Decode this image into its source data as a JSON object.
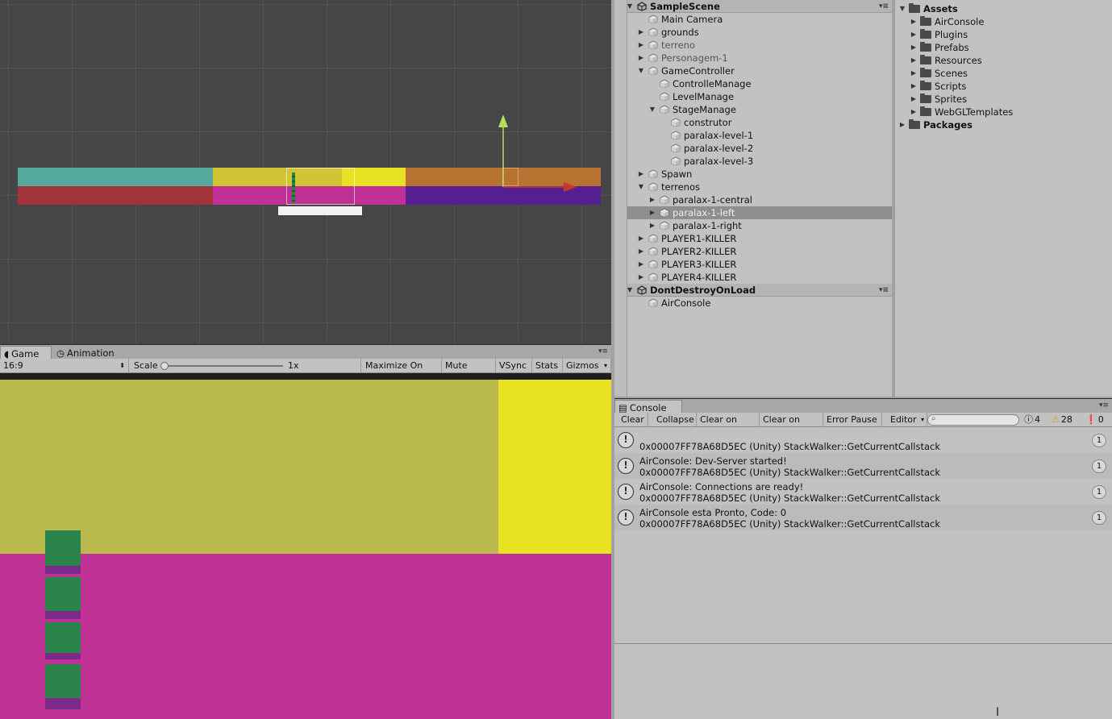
{
  "game_panel": {
    "tabs": [
      {
        "label": "Game",
        "active": true,
        "icon": "pacman-icon"
      },
      {
        "label": "Animation",
        "active": false,
        "icon": "clock-icon"
      }
    ],
    "toolbar": {
      "aspect": "16:9",
      "scale_label": "Scale",
      "scale_value": "1x",
      "maximize_on_play": "Maximize On Play",
      "mute_audio": "Mute Audio",
      "vsync": "VSync",
      "stats": "Stats",
      "gizmos": "Gizmos"
    }
  },
  "hierarchy": {
    "rows": [
      {
        "label": "SampleScene",
        "depth": 0,
        "fold": "open",
        "type": "scene"
      },
      {
        "label": "Main Camera",
        "depth": 1,
        "fold": "none"
      },
      {
        "label": "grounds",
        "depth": 1,
        "fold": "closed"
      },
      {
        "label": "terreno",
        "depth": 1,
        "fold": "closed",
        "dim": true
      },
      {
        "label": "Personagem-1",
        "depth": 1,
        "fold": "closed",
        "dim": true
      },
      {
        "label": "GameController",
        "depth": 1,
        "fold": "open"
      },
      {
        "label": "ControlleManage",
        "depth": 2,
        "fold": "none"
      },
      {
        "label": "LevelManage",
        "depth": 2,
        "fold": "none"
      },
      {
        "label": "StageManage",
        "depth": 2,
        "fold": "open"
      },
      {
        "label": "construtor",
        "depth": 3,
        "fold": "none"
      },
      {
        "label": "paralax-level-1",
        "depth": 3,
        "fold": "none"
      },
      {
        "label": "paralax-level-2",
        "depth": 3,
        "fold": "none"
      },
      {
        "label": "paralax-level-3",
        "depth": 3,
        "fold": "none"
      },
      {
        "label": "Spawn",
        "depth": 1,
        "fold": "closed"
      },
      {
        "label": "terrenos",
        "depth": 1,
        "fold": "open"
      },
      {
        "label": "paralax-1-central",
        "depth": 2,
        "fold": "closed"
      },
      {
        "label": "paralax-1-left",
        "depth": 2,
        "fold": "closed",
        "selected": true
      },
      {
        "label": "paralax-1-right",
        "depth": 2,
        "fold": "closed"
      },
      {
        "label": "PLAYER1-KILLER",
        "depth": 1,
        "fold": "closed"
      },
      {
        "label": "PLAYER2-KILLER",
        "depth": 1,
        "fold": "closed"
      },
      {
        "label": "PLAYER3-KILLER",
        "depth": 1,
        "fold": "closed"
      },
      {
        "label": "PLAYER4-KILLER",
        "depth": 1,
        "fold": "closed"
      },
      {
        "label": "DontDestroyOnLoad",
        "depth": 0,
        "fold": "open",
        "type": "scene"
      },
      {
        "label": "AirConsole",
        "depth": 1,
        "fold": "none"
      }
    ]
  },
  "project": {
    "rows": [
      {
        "label": "Assets",
        "depth": 0,
        "fold": "open",
        "bold": true
      },
      {
        "label": "AirConsole",
        "depth": 1,
        "fold": "closed"
      },
      {
        "label": "Plugins",
        "depth": 1,
        "fold": "closed"
      },
      {
        "label": "Prefabs",
        "depth": 1,
        "fold": "closed"
      },
      {
        "label": "Resources",
        "depth": 1,
        "fold": "closed"
      },
      {
        "label": "Scenes",
        "depth": 1,
        "fold": "closed"
      },
      {
        "label": "Scripts",
        "depth": 1,
        "fold": "closed"
      },
      {
        "label": "Sprites",
        "depth": 1,
        "fold": "closed"
      },
      {
        "label": "WebGLTemplates",
        "depth": 1,
        "fold": "closed"
      },
      {
        "label": "Packages",
        "depth": 0,
        "fold": "closed",
        "bold": true
      }
    ]
  },
  "console": {
    "tab_label": "Console",
    "toolbar": {
      "clear": "Clear",
      "collapse": "Collapse",
      "clear_on_play": "Clear on Play",
      "clear_on_build": "Clear on Build",
      "error_pause": "Error Pause",
      "editor": "Editor",
      "log_count": "4",
      "warn_count": "28",
      "error_count": "0"
    },
    "entries": [
      {
        "line1": "",
        "line2": "0x00007FF78A68D5EC (Unity) StackWalker::GetCurrentCallstack",
        "count": "1"
      },
      {
        "line1": "AirConsole: Dev-Server started!",
        "line2": "0x00007FF78A68D5EC (Unity) StackWalker::GetCurrentCallstack",
        "count": "1"
      },
      {
        "line1": "AirConsole: Connections are ready!",
        "line2": "0x00007FF78A68D5EC (Unity) StackWalker::GetCurrentCallstack",
        "count": "1"
      },
      {
        "line1": "AirConsole esta Pronto, Code: 0",
        "line2": "0x00007FF78A68D5EC (Unity) StackWalker::GetCurrentCallstack",
        "count": "1"
      }
    ]
  },
  "colors": {
    "teal": "#56a99d",
    "yellow_dim": "#d1c535",
    "yellow": "#e9e224",
    "orange": "#b87232",
    "red": "#a23338",
    "magenta": "#bf3195",
    "purple": "#561f90",
    "olive": "#b9b94d",
    "green": "#2b844a",
    "gizmo_arrow": "#b8df5a"
  }
}
